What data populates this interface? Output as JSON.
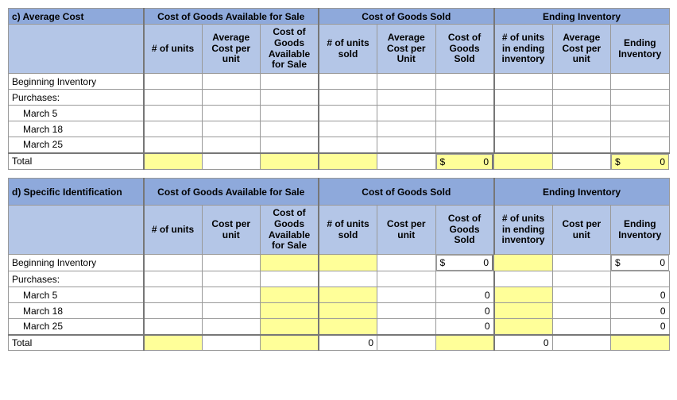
{
  "tableC": {
    "title": "c) Average Cost",
    "h1": "Cost of Goods Available for Sale",
    "h2": "Cost of Goods Sold",
    "h3": "Ending Inventory",
    "sub": {
      "c1": "# of units",
      "c2": "Average Cost per unit",
      "c3": "Cost of Goods Available for Sale",
      "c4": "# of units sold",
      "c5": "Average Cost per Unit",
      "c6": "Cost of Goods Sold",
      "c7": "# of units in ending inventory",
      "c8": "Average Cost per unit",
      "c9": "Ending Inventory"
    },
    "rows": {
      "begInv": "Beginning Inventory",
      "purch": "Purchases:",
      "m5": "March 5",
      "m18": "March 18",
      "m25": "March 25",
      "total": "Total"
    },
    "totalCogsSold": {
      "sym": "$",
      "val": "0"
    },
    "totalEndInv": {
      "sym": "$",
      "val": "0"
    }
  },
  "tableD": {
    "title": "d)  Specific Identification",
    "h1": "Cost of Goods Available for Sale",
    "h2": "Cost of Goods Sold",
    "h3": "Ending Inventory",
    "sub": {
      "c1": "# of units",
      "c2": "Cost per unit",
      "c3": "Cost of Goods Available for Sale",
      "c4": "# of units sold",
      "c5": "Cost per unit",
      "c6": "Cost of Goods Sold",
      "c7": "# of units in ending inventory",
      "c8": "Cost per unit",
      "c9": "Ending Inventory"
    },
    "rows": {
      "begInv": "Beginning Inventory",
      "purch": "Purchases:",
      "m5": "March 5",
      "m18": "March 18",
      "m25": "March 25",
      "total": "Total"
    },
    "begCogs": {
      "sym": "$",
      "val": "0"
    },
    "begEnd": {
      "sym": "$",
      "val": "0"
    },
    "m5Cogs": "0",
    "m5End": "0",
    "m18Cogs": "0",
    "m18End": "0",
    "m25Cogs": "0",
    "m25End": "0",
    "totalSold": "0",
    "totalEndUnits": "0"
  }
}
